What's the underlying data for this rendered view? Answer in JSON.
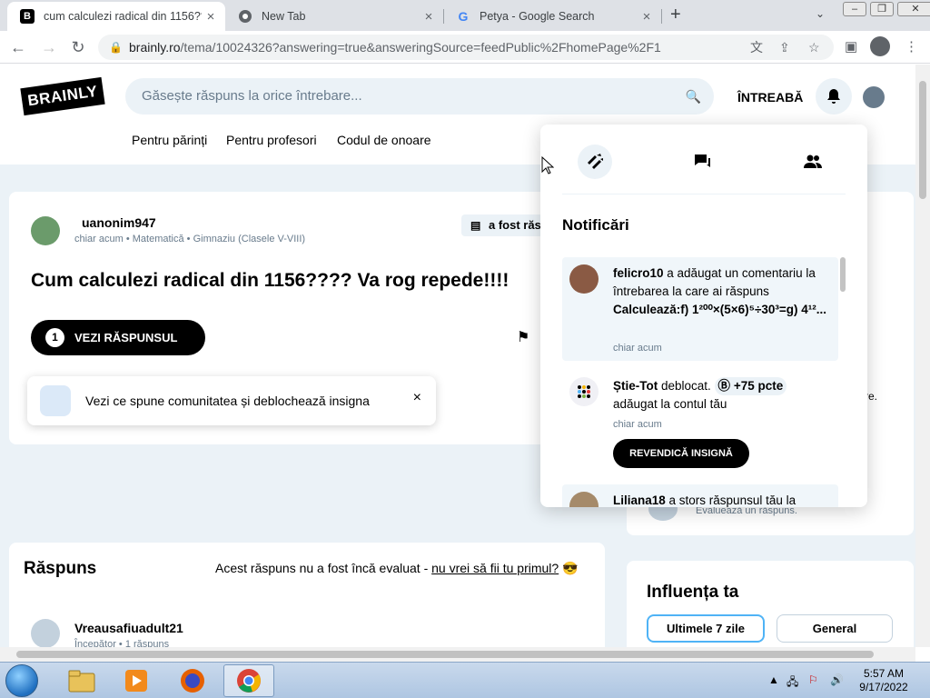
{
  "browser": {
    "tabs": [
      {
        "title": "cum calculezi radical din 1156???",
        "favicon": "brainly-icon",
        "close": "×"
      },
      {
        "title": "New Tab",
        "favicon": "chrome-icon",
        "close": "×"
      },
      {
        "title": "Petya - Google Search",
        "favicon": "google-icon",
        "close": "×"
      }
    ],
    "new_tab": "+",
    "url_domain": "brainly.ro",
    "url_path": "/tema/10024326?answering=true&answeringSource=feedPublic%2FhomePage%2F1"
  },
  "header": {
    "logo": "BRAINLY",
    "search_placeholder": "Găsește răspuns la orice întrebare...",
    "ask": "ÎNTREABĂ",
    "nav": [
      "Pentru părinți",
      "Pentru profesori",
      "Codul de onoare"
    ]
  },
  "question": {
    "user": "uanonim947",
    "time": "chiar acum",
    "subject": "Matematică",
    "level": "Gimnaziu (Clasele V-VIII)",
    "answered_badge": "a fost răs",
    "title": "Cum calculezi radical din 1156???? Va rog repede!!!!",
    "see_answer_count": "1",
    "see_answer": "VEZI RĂSPUNSUL"
  },
  "toast": {
    "text": "Vezi ce spune comunitatea și deblochează insigna",
    "close": "×"
  },
  "answer": {
    "heading": "Răspuns",
    "not_rated": "Acest răspuns nu a fost încă evaluat - ",
    "be_first": "nu vrei să fii tu primul?",
    "emoji": "😎",
    "user": "Vreausafiuadult21",
    "sub": "Începător • 1 răspuns"
  },
  "sidebar": {
    "cut_text": "re.",
    "rate": "Evaluează un răspuns.",
    "influence": "Influența ta",
    "btn_week": "Ultimele 7 zile",
    "btn_general": "General"
  },
  "notifications": {
    "heading": "Notificări",
    "items": [
      {
        "user": "felicro10",
        "text": " a adăugat un comentariu la întrebarea la care ai răspuns ",
        "snippet": "Calculează:f) 1²⁰⁰×(5×6)⁵÷30³=g) 4¹²...",
        "time": "chiar acum"
      },
      {
        "user": "Știe-Tot",
        "text": " deblocat. ",
        "points": "+75 pcte",
        "text2": "adăugat la contul tău",
        "time": "chiar acum",
        "button": "REVENDICĂ INSIGNĂ"
      },
      {
        "user": "Liliana18",
        "text": " a stors răspunsul tău la"
      }
    ]
  },
  "taskbar": {
    "time": "5:57 AM",
    "date": "9/17/2022"
  },
  "colors": {
    "accent_blue": "#4fb3f6",
    "light_bg": "#ebf2f7",
    "dark": "#000000"
  }
}
